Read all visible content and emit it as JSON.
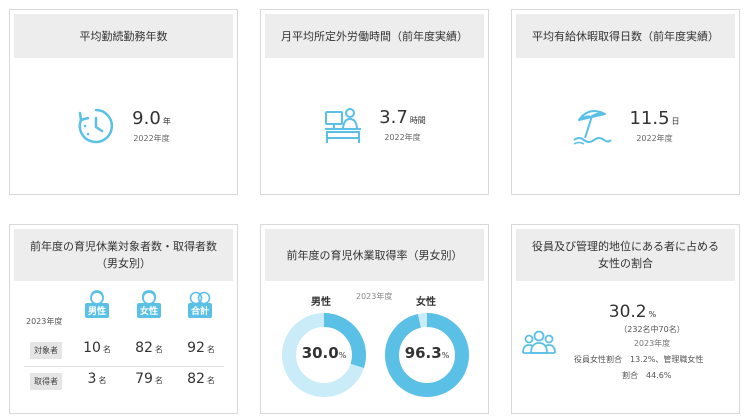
{
  "cards": {
    "tenure": {
      "title": "平均勤続勤務年数",
      "value": "9.0",
      "unit": "年",
      "year": "2022年度",
      "icon": "clock-rotate-icon"
    },
    "overtime": {
      "title": "月平均所定外労働時間（前年度実績）",
      "value": "3.7",
      "unit": "時間",
      "year": "2022年度",
      "icon": "desk-worker-icon"
    },
    "leave": {
      "title": "平均有給休暇取得日数（前年度実績）",
      "value": "11.5",
      "unit": "日",
      "year": "2022年度",
      "icon": "beach-umbrella-icon"
    },
    "childcare_counts": {
      "title": "前年度の育児休業対象者数・取得者数（男女別）",
      "year": "2023年度",
      "badges": {
        "male": "男性",
        "female": "女性",
        "total": "合計"
      },
      "unit": "名",
      "rows": [
        {
          "label": "対象者",
          "male": "10",
          "female": "82",
          "total": "92"
        },
        {
          "label": "取得者",
          "male": "3",
          "female": "79",
          "total": "82"
        }
      ]
    },
    "childcare_rate": {
      "title": "前年度の育児休業取得率（男女別）",
      "year": "2023年度",
      "male_label": "男性",
      "female_label": "女性",
      "male_value": "30.0",
      "female_value": "96.3",
      "percent": "%",
      "male_fraction": 0.3,
      "female_fraction": 0.963
    },
    "female_managers": {
      "title": "役員及び管理的地位にある者に占める女性の割合",
      "value": "30.2",
      "unit": "%",
      "detail": "（232名中70名）",
      "year": "2023年度",
      "note_line1": "役員女性割合　13.2%、管理職女性",
      "note_line2": "割合　44.6%",
      "icon": "people-group-icon"
    }
  },
  "colors": {
    "accent": "#5bc0e6",
    "accent_light": "#c9ecf8",
    "header_bg": "#ededed"
  }
}
